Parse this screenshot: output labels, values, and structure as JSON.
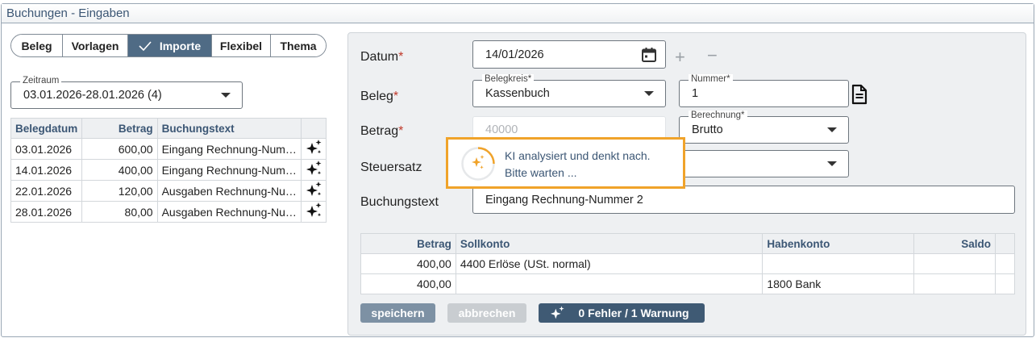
{
  "window": {
    "title": "Buchungen - Eingaben"
  },
  "tabs": [
    {
      "label": "Beleg",
      "active": false
    },
    {
      "label": "Vorlagen",
      "active": false
    },
    {
      "label": "Importe",
      "active": true
    },
    {
      "label": "Flexibel",
      "active": false
    },
    {
      "label": "Thema",
      "active": false
    }
  ],
  "zeitraum": {
    "legend": "Zeitraum",
    "value": "03.01.2026-28.01.2026 (4)"
  },
  "left_table": {
    "headers": [
      "Belegdatum",
      "Betrag",
      "Buchungstext"
    ],
    "rows": [
      [
        "03.01.2026",
        "600,00",
        "Eingang Rechnung-Num…"
      ],
      [
        "14.01.2026",
        "400,00",
        "Eingang Rechnung-Num…"
      ],
      [
        "22.01.2026",
        "120,00",
        "Ausgaben Rechnung-Nu…"
      ],
      [
        "28.01.2026",
        "80,00",
        "Ausgaben Rechnung-Nu…"
      ]
    ]
  },
  "form": {
    "datum_label": "Datum",
    "datum_value": "14/01/2026",
    "beleg_label": "Beleg",
    "belegkreis_legend": "Belegkreis*",
    "belegkreis_value": "Kassenbuch",
    "nummer_legend": "Nummer*",
    "nummer_value": "1",
    "betrag_label": "Betrag",
    "betrag_placeholder": "40000",
    "berechnung_legend": "Berechnung*",
    "berechnung_value": "Brutto",
    "steuersatz_label": "Steuersatz",
    "buchungstext_label": "Buchungstext",
    "buchungstext_value": "Eingang Rechnung-Nummer 2",
    "required_mark": "*"
  },
  "ai_overlay": {
    "line1": "KI analysiert und denkt nach.",
    "line2": "Bitte warten ..."
  },
  "right_table": {
    "headers": [
      "Betrag",
      "Sollkonto",
      "Habenkonto",
      "Saldo"
    ],
    "rows": [
      [
        "400,00",
        "4400 Erlöse (USt. normal)",
        "",
        ""
      ],
      [
        "400,00",
        "",
        "1800 Bank",
        ""
      ]
    ]
  },
  "buttons": {
    "save": "speichern",
    "cancel": "abbrechen",
    "status": "0 Fehler / 1 Warnung"
  },
  "colors": {
    "accent": "#4f6b85",
    "ai_border": "#f0a32a",
    "required": "#c0392b"
  }
}
